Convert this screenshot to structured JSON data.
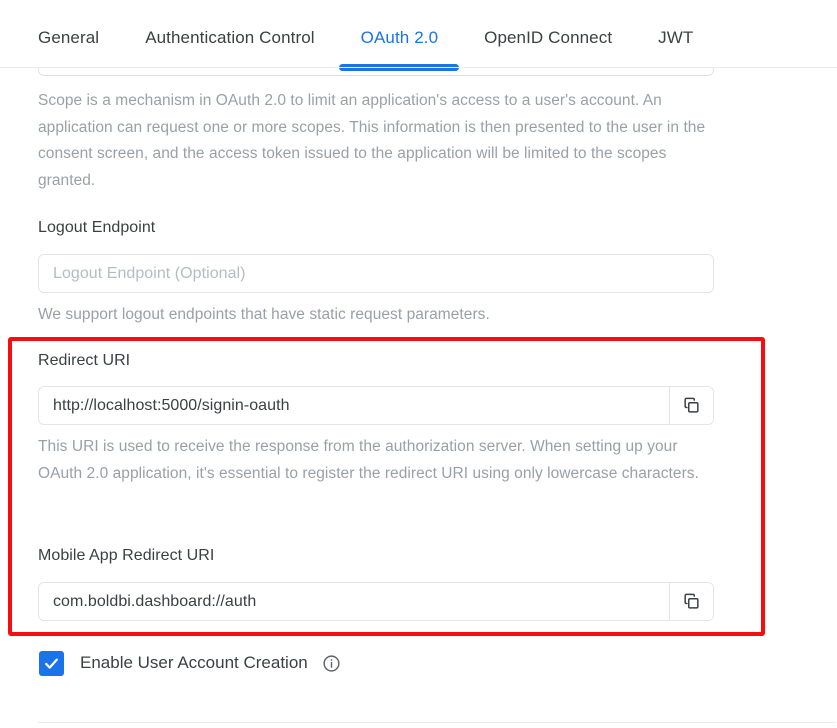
{
  "tabs": [
    {
      "label": "General",
      "active": false
    },
    {
      "label": "Authentication Control",
      "active": false
    },
    {
      "label": "OAuth 2.0",
      "active": true
    },
    {
      "label": "OpenID Connect",
      "active": false
    },
    {
      "label": "JWT",
      "active": false
    }
  ],
  "scope": {
    "cut_field_value": "",
    "description": "Scope is a mechanism in OAuth 2.0 to limit an application's access to a user's account. An application can request one or more scopes. This information is then presented to the user in the consent screen, and the access token issued to the application will be limited to the scopes granted."
  },
  "logout_endpoint": {
    "label": "Logout Endpoint",
    "placeholder": "Logout Endpoint (Optional)",
    "value": "",
    "helper": "We support logout endpoints that have static request parameters."
  },
  "redirect_uri": {
    "label": "Redirect URI",
    "value": "http://localhost:5000/signin-oauth",
    "helper": "This URI is used to receive the response from the authorization server. When setting up your OAuth 2.0 application, it's essential to register the redirect URI using only lowercase characters.",
    "copy_icon": "copy-icon"
  },
  "mobile_redirect_uri": {
    "label": "Mobile App Redirect URI",
    "value": "com.boldbi.dashboard://auth",
    "copy_icon": "copy-icon"
  },
  "enable_user_account_creation": {
    "label": "Enable User Account Creation",
    "checked": true,
    "info_icon": "info-icon"
  },
  "colors": {
    "accent": "#1a73e8",
    "highlight_border": "#f60d0d",
    "text": "#3c4043",
    "muted_text": "#9aa0a6",
    "placeholder": "#b7bcc2",
    "field_border": "#e3e5e8"
  }
}
